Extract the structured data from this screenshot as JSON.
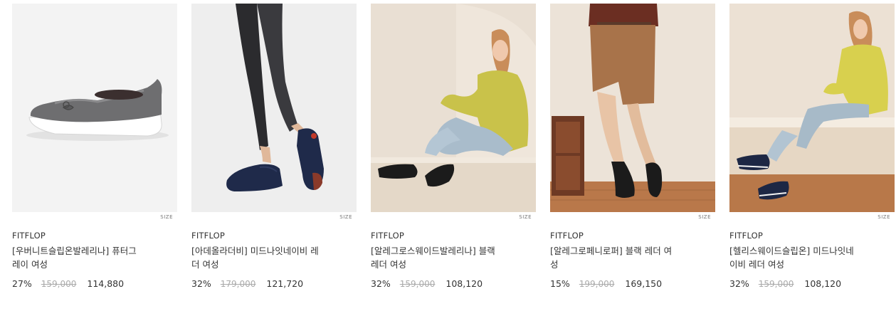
{
  "products": [
    {
      "brand": "FITFLOP",
      "size_label": "SIZE",
      "name_line1": "[우버니트슬립온발레리나] 퓨터그",
      "name_line2": "레이 여성",
      "discount": "27%",
      "original_price": "159,000",
      "sale_price": "114,880",
      "image": "grey-knit-slip-on-shoe"
    },
    {
      "brand": "FITFLOP",
      "size_label": "SIZE",
      "name_line1": "[아데올라더비] 미드나잇네이비 레",
      "name_line2": "더 여성",
      "discount": "32%",
      "original_price": "179,000",
      "sale_price": "121,720",
      "image": "model-legs-navy-derby"
    },
    {
      "brand": "FITFLOP",
      "size_label": "SIZE",
      "name_line1": "[알레그로스웨이드발레리나] 블랙",
      "name_line2": "레더 여성",
      "discount": "32%",
      "original_price": "159,000",
      "sale_price": "108,120",
      "image": "model-seated-black-ballerina"
    },
    {
      "brand": "FITFLOP",
      "size_label": "SIZE",
      "name_line1": "[알레그로페니로퍼] 블랙 레더 여",
      "name_line2": "성",
      "discount": "15%",
      "original_price": "199,000",
      "sale_price": "169,150",
      "image": "model-legs-black-loafer"
    },
    {
      "brand": "FITFLOP",
      "size_label": "SIZE",
      "name_line1": "[헬리스웨이드슬립온] 미드나잇네",
      "name_line2": "이비 레더 여성",
      "discount": "32%",
      "original_price": "159,000",
      "sale_price": "108,120",
      "image": "model-seated-navy-slip-on"
    }
  ]
}
